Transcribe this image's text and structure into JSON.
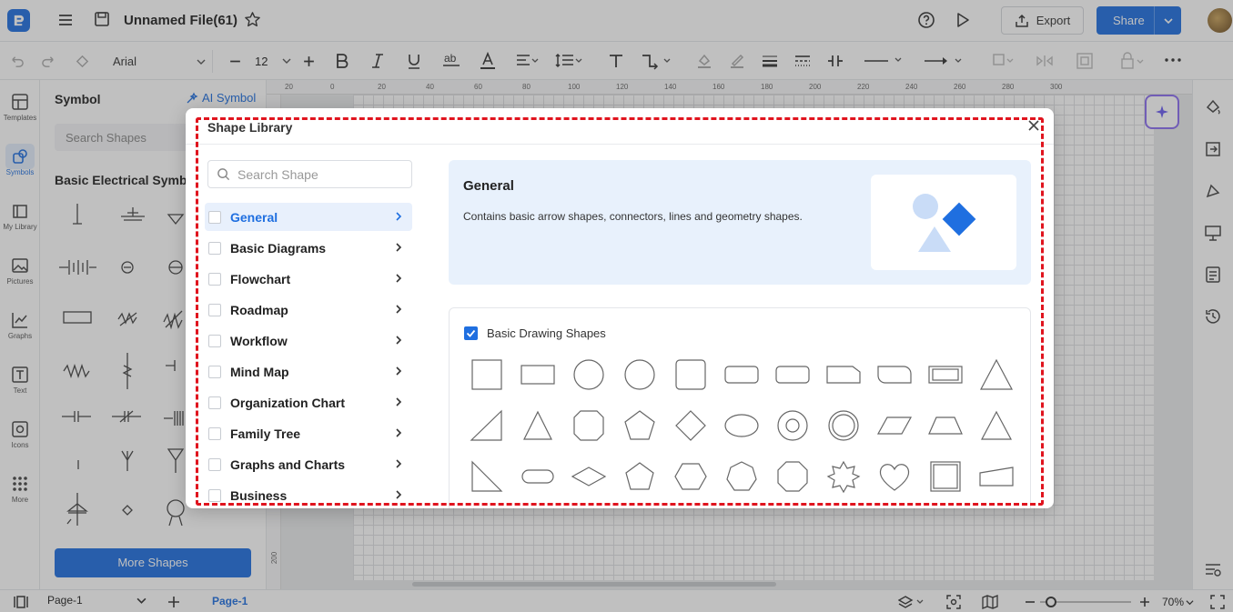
{
  "app": {
    "file_name": "Unnamed File(61)",
    "export_label": "Export",
    "share_label": "Share"
  },
  "toolbar": {
    "font": "Arial",
    "font_size": "12"
  },
  "leftnav": [
    {
      "label": "Templates",
      "icon": "templates-icon"
    },
    {
      "label": "Symbols",
      "icon": "symbols-icon"
    },
    {
      "label": "My Library",
      "icon": "library-icon"
    },
    {
      "label": "Pictures",
      "icon": "pictures-icon"
    },
    {
      "label": "Graphs",
      "icon": "graphs-icon"
    },
    {
      "label": "Text",
      "icon": "text-icon"
    },
    {
      "label": "Icons",
      "icon": "icons-icon"
    },
    {
      "label": "More",
      "icon": "more-icon"
    }
  ],
  "symbol_panel": {
    "title": "Symbol",
    "ai_label": "AI Symbol",
    "search_placeholder": "Search Shapes",
    "group_title": "Basic Electrical Symbo",
    "more_shapes": "More Shapes"
  },
  "ruler": {
    "top": [
      "20",
      "0",
      "20",
      "40",
      "60",
      "80",
      "100",
      "120",
      "140",
      "160",
      "180",
      "200",
      "220",
      "240",
      "260",
      "280",
      "300"
    ],
    "left": "200"
  },
  "modal": {
    "title": "Shape Library",
    "search_placeholder": "Search Shape",
    "categories": [
      "General",
      "Basic Diagrams",
      "Flowchart",
      "Roadmap",
      "Workflow",
      "Mind Map",
      "Organization Chart",
      "Family Tree",
      "Graphs and Charts",
      "Business"
    ],
    "selected_category": "General",
    "banner_title": "General",
    "banner_desc": "Contains basic arrow shapes, connectors, lines and geometry shapes.",
    "section_title": "Basic Drawing Shapes",
    "accent": "#1f6fe0"
  },
  "status": {
    "page_select": "Page-1",
    "page_tab": "Page-1",
    "zoom": "70%"
  }
}
